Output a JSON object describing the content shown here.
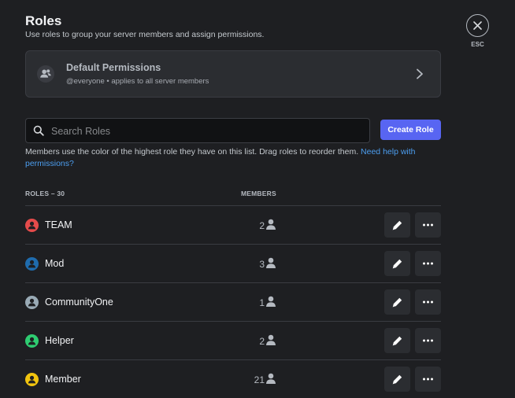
{
  "header": {
    "title": "Roles",
    "subtitle": "Use roles to group your server members and assign permissions."
  },
  "default_permissions": {
    "title": "Default Permissions",
    "description": "@everyone • applies to all server members",
    "icon": "people-icon"
  },
  "search": {
    "placeholder": "Search Roles",
    "value": ""
  },
  "create_role_label": "Create Role",
  "help": {
    "text": "Members use the color of the highest role they have on this list. Drag roles to reorder them. ",
    "link": "Need help with permissions?"
  },
  "columns": {
    "roles": "ROLES – 30",
    "members": "MEMBERS"
  },
  "roles": [
    {
      "name": "TEAM",
      "members": "2",
      "color": "#e54b4b"
    },
    {
      "name": "Mod",
      "members": "3",
      "color": "#1f6cae"
    },
    {
      "name": "CommunityOne",
      "members": "1",
      "color": "#99aab5"
    },
    {
      "name": "Helper",
      "members": "2",
      "color": "#2ecc71"
    },
    {
      "name": "Member",
      "members": "21",
      "color": "#f1c40f"
    }
  ],
  "close": {
    "label": "ESC"
  }
}
